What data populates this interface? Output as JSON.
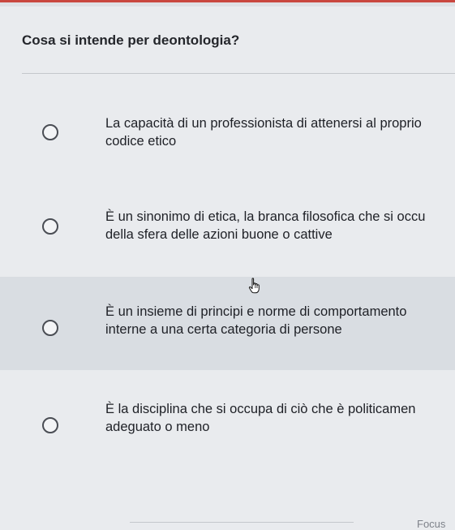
{
  "question": {
    "title": "Cosa si intende per deontologia?"
  },
  "options": [
    {
      "line1": "La capacità di un professionista di attenersi al proprio",
      "line2": "codice etico",
      "selected": false
    },
    {
      "line1": "È un sinonimo di etica, la branca filosofica che si occu",
      "line2": "della sfera delle azioni buone o cattive",
      "selected": false
    },
    {
      "line1": "È un insieme di principi e norme di comportamento",
      "line2": "interne a una certa categoria di persone",
      "selected": false
    },
    {
      "line1": "È la disciplina che si occupa di ciò che è politicamen",
      "line2": "adeguato o meno",
      "selected": false
    }
  ],
  "footer": {
    "focus_label": "Focus"
  },
  "colors": {
    "accent_strip": "#c9473f",
    "hover_background": "#d9dde2",
    "page_background": "#e9ebee"
  },
  "icons": {
    "cursor": "hand-pointer-icon"
  }
}
